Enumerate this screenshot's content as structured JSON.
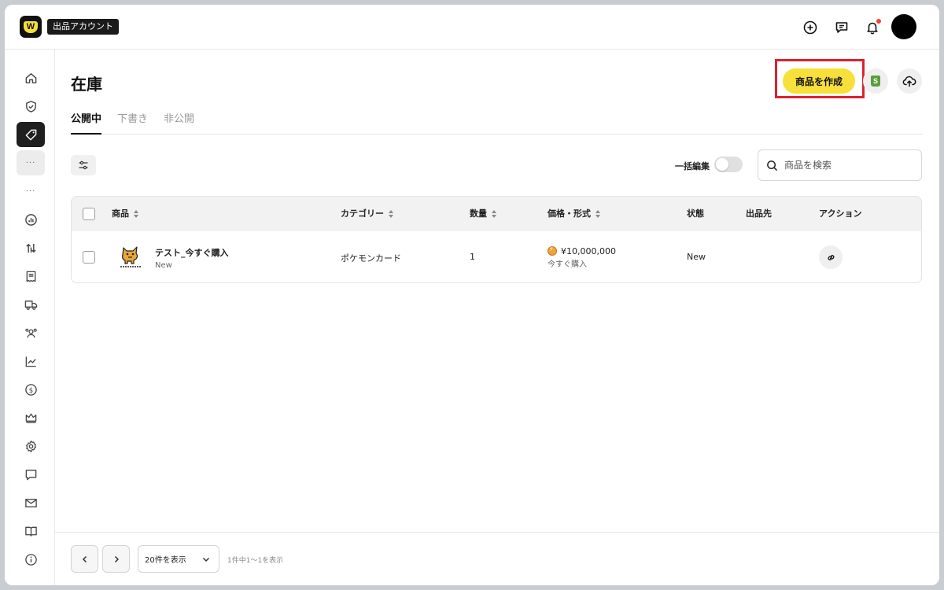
{
  "header": {
    "logo_letter": "W",
    "account_badge": "出品アカウント",
    "icons": [
      "plus-circle-icon",
      "message-icon",
      "bell-icon"
    ],
    "notification_dot_color": "#f04438"
  },
  "sidebar": {
    "items": [
      {
        "icon": "home-icon",
        "active": false
      },
      {
        "icon": "shield-check-icon",
        "active": false
      },
      {
        "icon": "tag-icon",
        "active": true
      },
      {
        "icon": "more-dots",
        "label": "···"
      },
      {
        "icon": "more-dots",
        "label": "···"
      },
      {
        "icon": "analytics-icon"
      },
      {
        "icon": "transfer-icon"
      },
      {
        "icon": "receipt-icon"
      },
      {
        "icon": "truck-icon"
      },
      {
        "icon": "users-icon"
      },
      {
        "icon": "trend-icon"
      },
      {
        "icon": "dollar-icon"
      },
      {
        "icon": "crown-icon"
      },
      {
        "icon": "settings-icon"
      },
      {
        "icon": "chat-icon"
      },
      {
        "icon": "mail-icon"
      },
      {
        "icon": "book-icon"
      },
      {
        "icon": "info-icon"
      }
    ]
  },
  "page": {
    "title": "在庫",
    "create_button": "商品を作成",
    "highlight_color": "#e0202e",
    "accent_color": "#f7e03a",
    "tabs": [
      {
        "label": "公開中",
        "active": true
      },
      {
        "label": "下書き",
        "active": false
      },
      {
        "label": "非公開",
        "active": false
      }
    ],
    "bulk_edit_label": "一括編集",
    "bulk_edit_on": false,
    "search_placeholder": "商品を検索"
  },
  "table": {
    "columns": [
      "商品",
      "カテゴリー",
      "数量",
      "価格・形式",
      "状態",
      "出品先",
      "アクション"
    ],
    "rows": [
      {
        "name": "テスト_今すぐ購入",
        "condition_sub": "New",
        "category": "ポケモンカード",
        "quantity": "1",
        "price": "¥10,000,000",
        "format": "今すぐ購入",
        "status": "New",
        "listing_destination": ""
      }
    ]
  },
  "footer": {
    "per_page": "20件を表示",
    "range_text": "1件中1〜1を表示"
  }
}
